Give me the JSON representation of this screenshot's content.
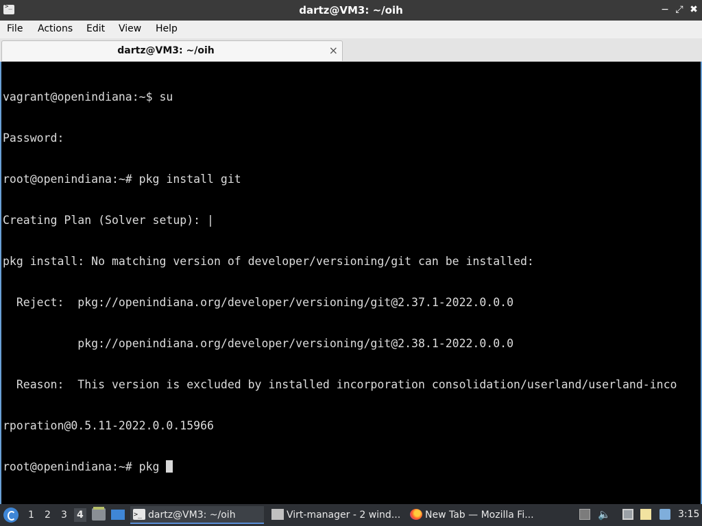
{
  "window": {
    "title": "dartz@VM3: ~/oih",
    "controls": {
      "minimize": "−",
      "maximize": "⤢",
      "close": "✖"
    }
  },
  "menubar": {
    "items": [
      "File",
      "Actions",
      "Edit",
      "View",
      "Help"
    ]
  },
  "tabs": [
    {
      "label": "dartz@VM3: ~/oih",
      "close": "×"
    }
  ],
  "terminal": {
    "lines": [
      "vagrant@openindiana:~$ su",
      "Password:",
      "root@openindiana:~# pkg install git",
      "Creating Plan (Solver setup): |",
      "pkg install: No matching version of developer/versioning/git can be installed:",
      "  Reject:  pkg://openindiana.org/developer/versioning/git@2.37.1-2022.0.0.0",
      "           pkg://openindiana.org/developer/versioning/git@2.38.1-2022.0.0.0",
      "  Reason:  This version is excluded by installed incorporation consolidation/userland/userland-inco",
      "rporation@0.5.11-2022.0.0.15966",
      "root@openindiana:~# pkg "
    ]
  },
  "taskbar": {
    "workspaces": [
      "1",
      "2",
      "3",
      "4"
    ],
    "active_workspace": "4",
    "tasks": [
      {
        "label": "dartz@VM3: ~/oih",
        "icon": "terminal-icon"
      },
      {
        "label": "Virt-manager - 2 wind...",
        "icon": "virt-manager-icon"
      },
      {
        "label": "New Tab — Mozilla Fi...",
        "icon": "firefox-icon"
      }
    ],
    "tray": {
      "volume": "🔈"
    },
    "clock": "3:15"
  }
}
